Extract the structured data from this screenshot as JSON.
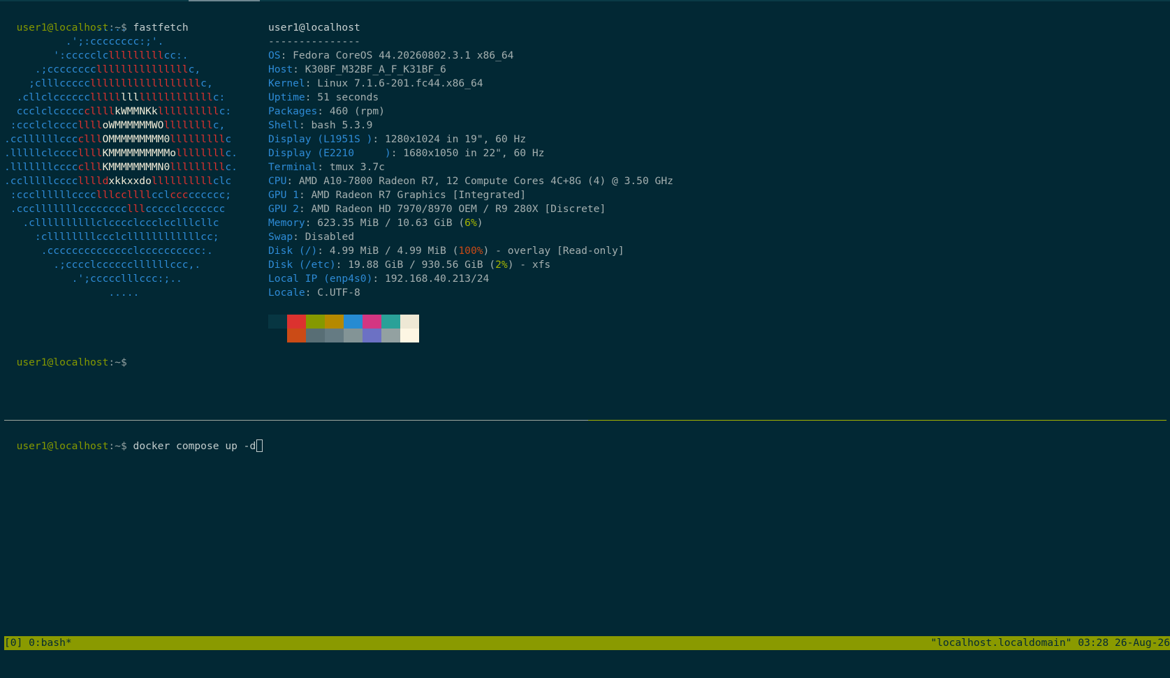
{
  "terminal": {
    "prompt": "user1@localhost",
    "prompt_suffix": ":~$",
    "command1": "fastfetch",
    "command2": "docker compose up -d"
  },
  "logo_lines": [
    [
      [
        "b",
        "               .....       "
      ]
    ],
    [
      [
        "b",
        "          .';:cccccccc:;'.   "
      ]
    ],
    [
      [
        "b",
        "        ':ccccclc"
      ],
      [
        "r",
        "lllllllll"
      ],
      [
        "b",
        "cc:.  "
      ]
    ],
    [
      [
        "b",
        "     .;cccccccc"
      ],
      [
        "r",
        "lllllllllllllll"
      ],
      [
        "b",
        "c,  "
      ]
    ],
    [
      [
        "b",
        "    ;clllccccc"
      ],
      [
        "r",
        "llllllllllllllllll"
      ],
      [
        "b",
        "c,  "
      ]
    ],
    [
      [
        "b",
        "  .cllclcccccc"
      ],
      [
        "r",
        "lllll"
      ],
      [
        "w",
        "lll"
      ],
      [
        "r",
        "llllllllllll"
      ],
      [
        "b",
        "c:  "
      ]
    ],
    [
      [
        "b",
        "  ccclclccccc"
      ],
      [
        "r",
        "cllll"
      ],
      [
        "w",
        "kWMMNKk"
      ],
      [
        "r",
        "llllllllll"
      ],
      [
        "b",
        "c:  "
      ]
    ],
    [
      [
        "b",
        " :ccclclcccc"
      ],
      [
        "r",
        "llll"
      ],
      [
        "w",
        "oWMMMMMMWO"
      ],
      [
        "r",
        "llllllll"
      ],
      [
        "b",
        "c,  "
      ]
    ],
    [
      [
        "b",
        ".ccllllllccc"
      ],
      [
        "r",
        "clll"
      ],
      [
        "w",
        "OMMMMMMMMM0"
      ],
      [
        "r",
        "lllllllll"
      ],
      [
        "b",
        "c  "
      ]
    ],
    [
      [
        "b",
        ".lllllclcccc"
      ],
      [
        "r",
        "llll"
      ],
      [
        "w",
        "KMMMMMMMMMMo"
      ],
      [
        "r",
        "llllllll"
      ],
      [
        "b",
        "c.  "
      ]
    ],
    [
      [
        "b",
        ".lllllllcccc"
      ],
      [
        "r",
        "clll"
      ],
      [
        "w",
        "KMMMMMMMMN0"
      ],
      [
        "r",
        "lllllllll"
      ],
      [
        "b",
        "c.  "
      ]
    ],
    [
      [
        "b",
        ".cclllllcccc"
      ],
      [
        "r",
        "lllld"
      ],
      [
        "w",
        "xkkxxdo"
      ],
      [
        "r",
        "llllllllll"
      ],
      [
        "b",
        "clc  "
      ]
    ],
    [
      [
        "b",
        " :cccllllllcccc"
      ],
      [
        "r",
        "lllccllll"
      ],
      [
        "b",
        "ccl"
      ],
      [
        "r",
        "ccc"
      ],
      [
        "b",
        "cccccc;  "
      ]
    ],
    [
      [
        "b",
        " .ccclllllllcccccccc"
      ],
      [
        "r",
        "lll"
      ],
      [
        "b",
        "ccccclccccccc  "
      ]
    ],
    [
      [
        "b",
        "   .cllllllllllclcccclccclcclllcllc  "
      ]
    ],
    [
      [
        "b",
        "     :cllllllllccclcllllllllllllcc;  "
      ]
    ],
    [
      [
        "b",
        "      .cccccccccccccclcccccccccc:.  "
      ]
    ],
    [
      [
        "b",
        "        .;cccclccccccllllllccc,.  "
      ]
    ],
    [
      [
        "b",
        "           .';ccccclllccc:;..  "
      ]
    ],
    [
      [
        "b",
        "                 .....       "
      ]
    ]
  ],
  "info": {
    "title": "user1@localhost",
    "separator": "---------------",
    "rows": [
      [
        [
          "key",
          "OS"
        ],
        [
          "val",
          ": Fedora CoreOS 44.20260802.3.1 x86_64"
        ]
      ],
      [
        [
          "key",
          "Host"
        ],
        [
          "val",
          ": K30BF_M32BF_A_F_K31BF_6"
        ]
      ],
      [
        [
          "key",
          "Kernel"
        ],
        [
          "val",
          ": Linux 7.1.6-201.fc44.x86_64"
        ]
      ],
      [
        [
          "key",
          "Uptime"
        ],
        [
          "val",
          ": 51 seconds"
        ]
      ],
      [
        [
          "key",
          "Packages"
        ],
        [
          "val",
          ": 460 (rpm)"
        ]
      ],
      [
        [
          "key",
          "Shell"
        ],
        [
          "val",
          ": bash 5.3.9"
        ]
      ],
      [
        [
          "key",
          "Display (L1951S )"
        ],
        [
          "val",
          ": 1280x1024 in 19\", 60 Hz"
        ]
      ],
      [
        [
          "key",
          "Display (E2210     )"
        ],
        [
          "val",
          ": 1680x1050 in 22\", 60 Hz"
        ]
      ],
      [
        [
          "key",
          "Terminal"
        ],
        [
          "val",
          ": tmux 3.7c"
        ]
      ],
      [
        [
          "key",
          "CPU"
        ],
        [
          "val",
          ": AMD A10-7800 Radeon R7, 12 Compute Cores 4C+8G (4) @ 3.50 GHz"
        ]
      ],
      [
        [
          "key",
          "GPU 1"
        ],
        [
          "val",
          ": AMD Radeon R7 Graphics [Integrated]"
        ]
      ],
      [
        [
          "key",
          "GPU 2"
        ],
        [
          "val",
          ": AMD Radeon HD 7970/8970 OEM / R9 280X [Discrete]"
        ]
      ],
      [
        [
          "key",
          "Memory"
        ],
        [
          "val",
          ": 623.35 MiB / 10.63 GiB ("
        ],
        [
          "pct-green",
          "6%"
        ],
        [
          "val",
          ")"
        ]
      ],
      [
        [
          "key",
          "Swap"
        ],
        [
          "val",
          ": Disabled"
        ]
      ],
      [
        [
          "key",
          "Disk (/)"
        ],
        [
          "val",
          ": 4.99 MiB / 4.99 MiB ("
        ],
        [
          "pct-red",
          "100%"
        ],
        [
          "val",
          ") - overlay [Read-only]"
        ]
      ],
      [
        [
          "key",
          "Disk (/etc)"
        ],
        [
          "val",
          ": 19.88 GiB / 930.56 GiB ("
        ],
        [
          "pct-green",
          "2%"
        ],
        [
          "val",
          ") - xfs"
        ]
      ],
      [
        [
          "key",
          "Local IP (enp4s0)"
        ],
        [
          "val",
          ": 192.168.40.213/24"
        ]
      ],
      [
        [
          "key",
          "Locale"
        ],
        [
          "val",
          ": C.UTF-8"
        ]
      ]
    ]
  },
  "palette": {
    "normal": [
      "#073642",
      "#dc322f",
      "#859900",
      "#b58900",
      "#268bd2",
      "#d33682",
      "#2aa198",
      "#eee8d5"
    ],
    "bright": [
      "#022834",
      "#cb4b16",
      "#586e75",
      "#657b83",
      "#839496",
      "#6c71c4",
      "#93a1a1",
      "#fdf6e3"
    ]
  },
  "status": {
    "left": "[0] 0:bash*",
    "right": "\"localhost.localdomain\" 03:28 26-Aug-26"
  }
}
